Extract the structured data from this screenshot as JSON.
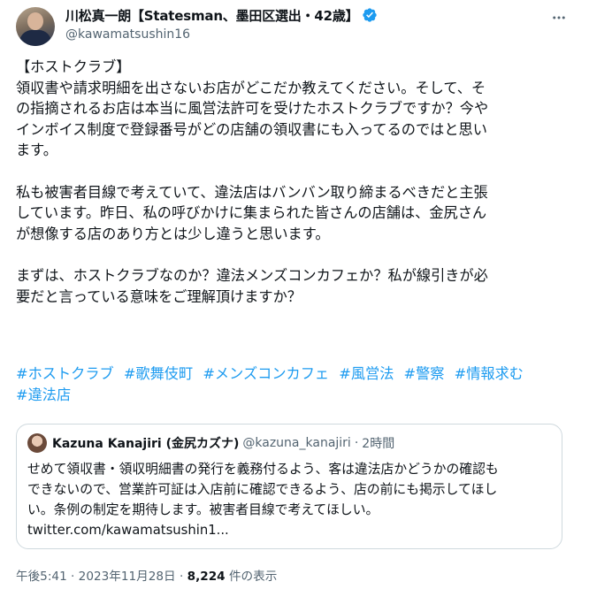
{
  "author": {
    "display_name": "川松真一朗【Statesman、墨田区選出・42歳】",
    "handle": "@kawamatsushin16"
  },
  "body": {
    "lines_p1": [
      "【ホストクラブ】",
      "領収書や請求明細を出さないお店がどこだか教えてください。そして、そ",
      "の指摘されるお店は本当に風営法許可を受けたホストクラブですか？今や",
      "インボイス制度で登録番号がどの店舗の領収書にも入ってるのではと思い",
      "ます。"
    ],
    "lines_p2": [
      "私も被害者目線で考えていて、違法店はバンバン取り締まるべきだと主張",
      "しています。昨日、私の呼びかけに集まられた皆さんの店舗は、金尻さん",
      "が想像する店のあり方とは少し違うと思います。"
    ],
    "lines_p3": [
      "まずは、ホストクラブなのか？違法メンズコンカフェか？私が線引きが必",
      "要だと言っている意味をご理解頂けますか？"
    ],
    "hashtags": [
      "#ホストクラブ",
      "#歌舞伎町",
      "#メンズコンカフェ",
      "#風営法",
      "#警察",
      "#情報求む",
      "#違法店"
    ]
  },
  "quote": {
    "display_name": "Kazuna Kanajiri (金尻カズナ)",
    "handle": "@kazuna_kanajiri",
    "separator": "·",
    "time": "2時間",
    "lines": [
      "せめて領収書・領収明細書の発行を義務付るよう、客は違法店かどうかの確認も",
      "できないので、営業許可証は入店前に確認できるよう、店の前にも掲示してほし",
      "い。条例の制定を期待します。被害者目線で考えてほしい。",
      "twitter.com/kawamatsushin1..."
    ]
  },
  "meta": {
    "time": "午後5:41 · 2023年11月28日 · ",
    "views_count": "8,224",
    "views_label": " 件の表示"
  },
  "colors": {
    "link": "#1d9bf0",
    "secondary": "#536471",
    "verified": "#1d9bf0"
  },
  "icons": {
    "verified": "verified-badge-icon",
    "more": "more-options-icon"
  }
}
